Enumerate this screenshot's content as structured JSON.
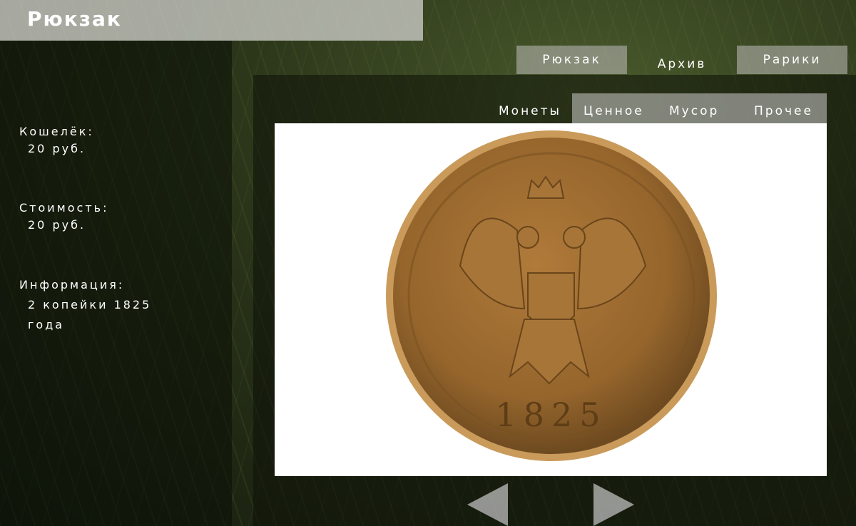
{
  "header": {
    "title": "Рюкзак"
  },
  "top_tabs": [
    {
      "label": "Рюкзак"
    },
    {
      "label": "Архив",
      "active": true
    },
    {
      "label": "Рарики"
    }
  ],
  "sub_tabs": [
    {
      "label": "Монеты",
      "active": true
    },
    {
      "label": "Ценное"
    },
    {
      "label": "Мусор"
    },
    {
      "label": "Прочее"
    }
  ],
  "info": {
    "wallet_label": "Кошелёк:",
    "wallet_value": "20 руб.",
    "cost_label": "Стоимость:",
    "cost_value": "20 руб.",
    "info_label": "Информация:",
    "info_value_1": "2 копейки 1825",
    "info_value_2": "года"
  },
  "item": {
    "coin_year": "1825",
    "coin_color": "#9a6a2e"
  },
  "nav": {
    "prev": "arrow-left",
    "next": "arrow-right"
  }
}
